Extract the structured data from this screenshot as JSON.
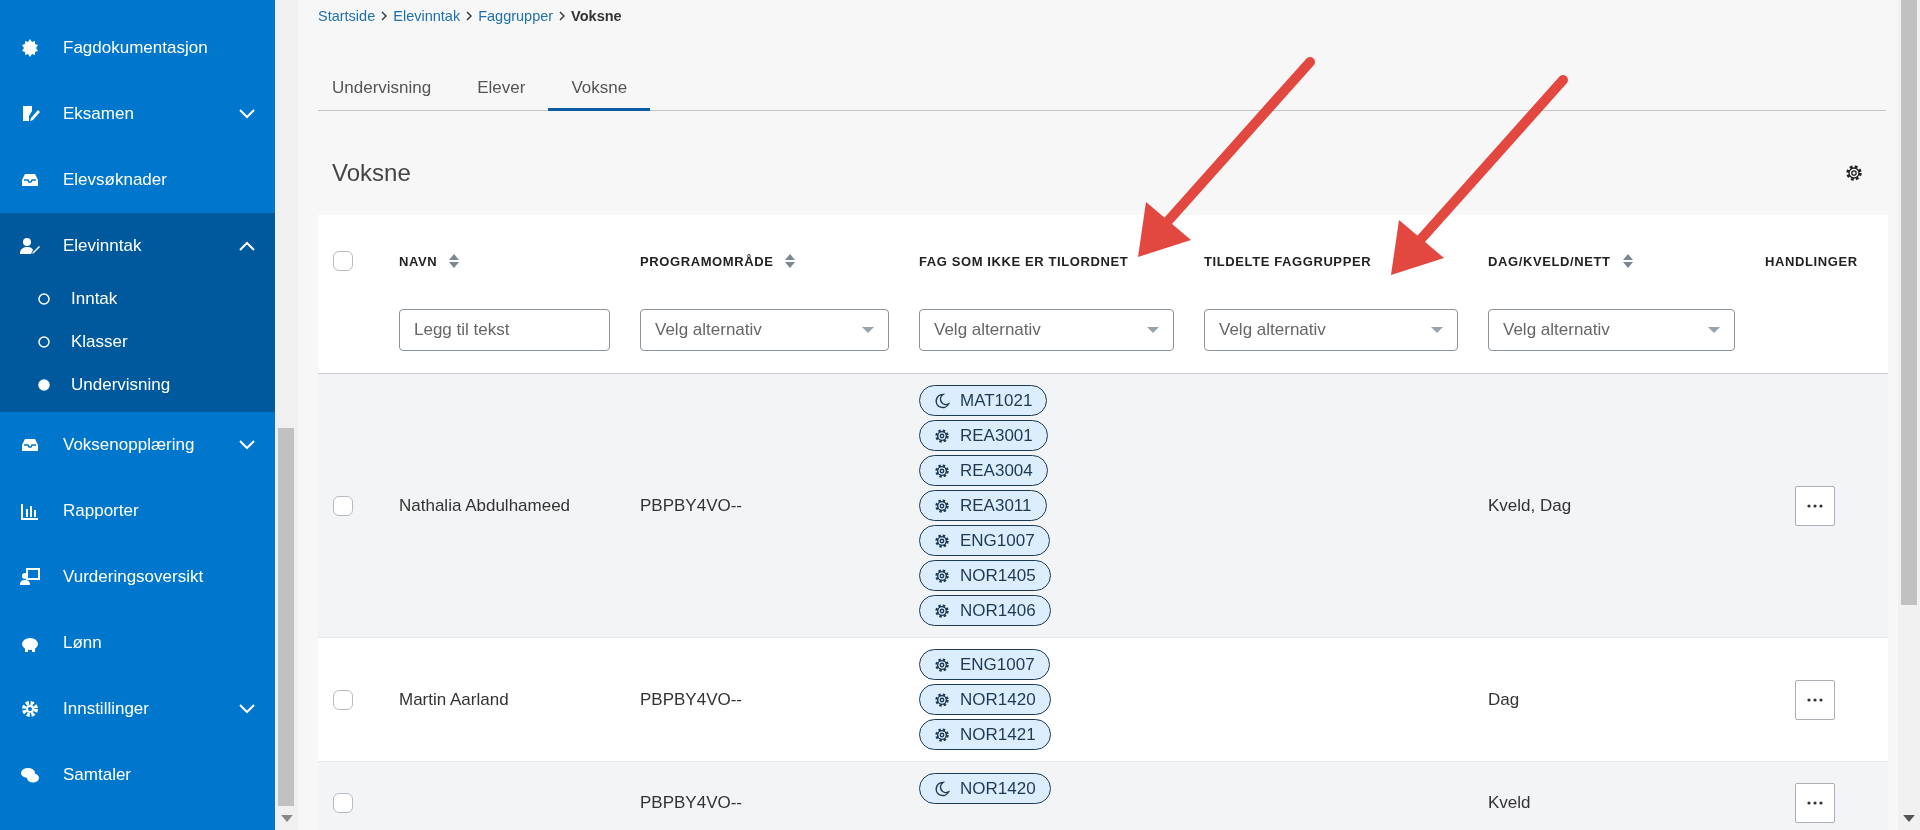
{
  "sidebar": {
    "items": [
      {
        "label": "Fagdokumentasjon"
      },
      {
        "label": "Eksamen",
        "expanded": false
      },
      {
        "label": "Elevsøknader"
      },
      {
        "label": "Elevinntak",
        "expanded": true,
        "children": [
          {
            "label": "Inntak",
            "selected": false
          },
          {
            "label": "Klasser",
            "selected": false
          },
          {
            "label": "Undervisning",
            "selected": true
          }
        ]
      },
      {
        "label": "Voksenopplæring",
        "expanded": false
      },
      {
        "label": "Rapporter"
      },
      {
        "label": "Vurderingsoversikt"
      },
      {
        "label": "Lønn"
      },
      {
        "label": "Innstillinger",
        "expanded": false
      },
      {
        "label": "Samtaler"
      }
    ]
  },
  "breadcrumb": [
    {
      "label": "Startside",
      "current": false
    },
    {
      "label": "Elevinntak",
      "current": false
    },
    {
      "label": "Faggrupper",
      "current": false
    },
    {
      "label": "Voksne",
      "current": true
    }
  ],
  "tabs": [
    {
      "label": "Undervisning",
      "selected": false
    },
    {
      "label": "Elever",
      "selected": false
    },
    {
      "label": "Voksne",
      "selected": true
    }
  ],
  "page_title": "Voksne",
  "table": {
    "select_all": {
      "checked": false
    },
    "columns": [
      {
        "label": "NAVN",
        "sortable": true,
        "filter": {
          "kind": "text",
          "placeholder": "Legg til tekst"
        }
      },
      {
        "label": "PROGRAMOMRÅDE",
        "sortable": true,
        "filter": {
          "kind": "select",
          "placeholder": "Velg alternativ"
        }
      },
      {
        "label": "FAG SOM IKKE ER TILORDNET",
        "filter": {
          "kind": "select",
          "placeholder": "Velg alternativ"
        }
      },
      {
        "label": "TILDELTE FAGGRUPPER",
        "filter": {
          "kind": "select",
          "placeholder": "Velg alternativ"
        }
      },
      {
        "label": "DAG/KVELD/NETT",
        "sortable": true,
        "filter": {
          "kind": "select",
          "placeholder": "Velg alternativ"
        }
      },
      {
        "label": "HANDLINGER"
      }
    ],
    "rows": [
      {
        "checked": false,
        "name": "Nathalia Abdulhameed",
        "program": "PBPBY4VO--",
        "subjects": [
          {
            "code": "MAT1021",
            "kind": "moon"
          },
          {
            "code": "REA3001",
            "kind": "gear"
          },
          {
            "code": "REA3004",
            "kind": "gear"
          },
          {
            "code": "REA3011",
            "kind": "gear"
          },
          {
            "code": "ENG1007",
            "kind": "gear"
          },
          {
            "code": "NOR1405",
            "kind": "gear"
          },
          {
            "code": "NOR1406",
            "kind": "gear"
          }
        ],
        "time": "Kveld, Dag"
      },
      {
        "checked": false,
        "name": "Martin Aarland",
        "program": "PBPBY4VO--",
        "subjects": [
          {
            "code": "ENG1007",
            "kind": "gear"
          },
          {
            "code": "NOR1420",
            "kind": "gear"
          },
          {
            "code": "NOR1421",
            "kind": "gear"
          }
        ],
        "time": "Dag"
      },
      {
        "checked": false,
        "program": "PBPBY4VO--",
        "subjects": [
          {
            "code": "NOR1420",
            "kind": "moon"
          }
        ],
        "time": "Kveld"
      }
    ]
  }
}
